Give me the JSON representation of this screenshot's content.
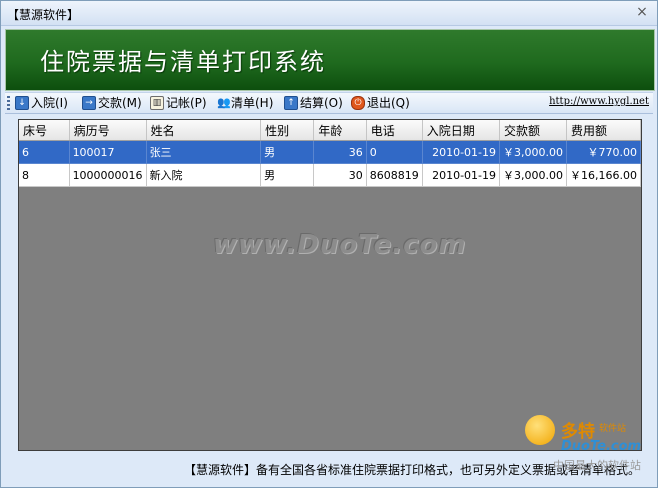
{
  "window": {
    "title": "【慧源软件】",
    "close_symbol": "×",
    "banner_title": "住院票据与清单打印系统"
  },
  "toolbar": {
    "items": [
      {
        "label": "入院(I)",
        "icon": "admit-icon"
      },
      {
        "label": "交款(M)",
        "icon": "payment-icon"
      },
      {
        "label": "记帐(P)",
        "icon": "ledger-book-icon"
      },
      {
        "label": "清单(H)",
        "icon": "people-list-icon"
      },
      {
        "label": "结算(O)",
        "icon": "settle-icon"
      },
      {
        "label": "退出(Q)",
        "icon": "exit-icon"
      }
    ],
    "link": "http://www.hygl.net"
  },
  "grid": {
    "columns": [
      "床号",
      "病历号",
      "姓名",
      "性别",
      "年龄",
      "电话",
      "入院日期",
      "交款额",
      "费用额"
    ],
    "rows": [
      {
        "bed": "6",
        "record": "100017",
        "name": "张三",
        "gender": "男",
        "age": "36",
        "phone": "0",
        "admit_date": "2010-01-19",
        "paid": "￥3,000.00",
        "cost": "￥770.00"
      },
      {
        "bed": "8",
        "record": "1000000016",
        "name": "新入院",
        "gender": "男",
        "age": "30",
        "phone": "8608819",
        "admit_date": "2010-01-19",
        "paid": "￥3,000.00",
        "cost": "￥16,166.00"
      }
    ],
    "selected_row": 0
  },
  "watermark": "www.DuoTe.com",
  "footer_text": "【慧源软件】备有全国各省标准住院票据打印格式，也可另外定义票据或者清单格式。",
  "logo": {
    "cn": "多特",
    "sub": "软件站",
    "en": "DuoTe.com",
    "tagline": "中国最大的软件站"
  }
}
